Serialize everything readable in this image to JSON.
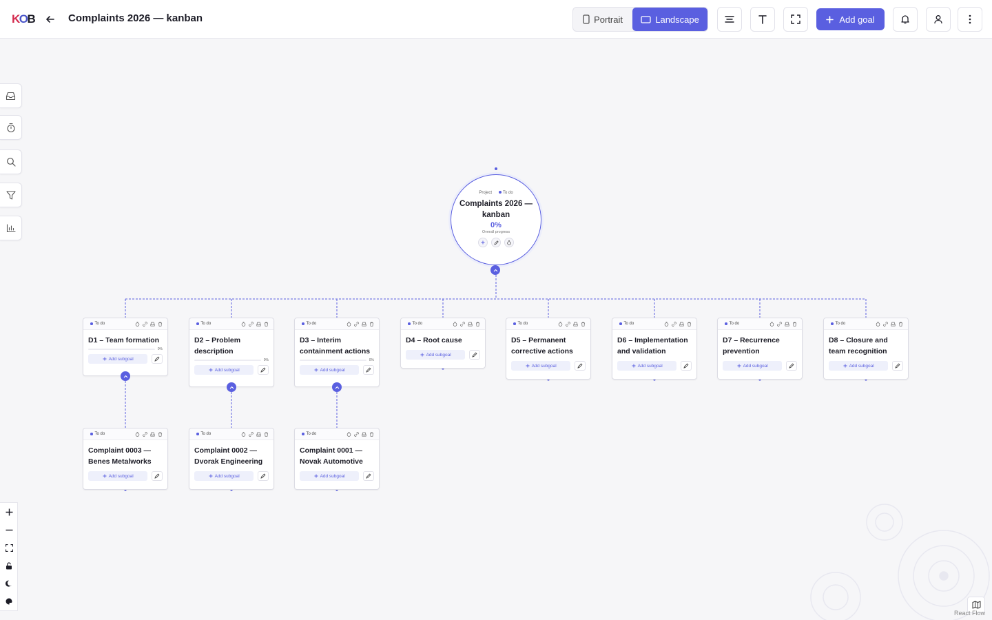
{
  "header": {
    "title": "Complaints 2026 — kanban",
    "orientation": {
      "portrait_label": "Portrait",
      "landscape_label": "Landscape",
      "selected": "landscape"
    },
    "add_goal_label": "Add goal",
    "icons": [
      "arrow-left-icon",
      "align-icon",
      "text-icon",
      "fullscreen-icon",
      "plus-icon",
      "bell-icon",
      "user-icon",
      "kebab-icon"
    ]
  },
  "sidebar": {
    "tools": [
      {
        "name": "inbox-icon"
      },
      {
        "name": "timer-icon"
      },
      {
        "name": "search-icon"
      },
      {
        "name": "filter-icon"
      },
      {
        "name": "chart-icon"
      }
    ]
  },
  "zoom_controls": [
    "zoom-in-icon",
    "zoom-out-icon",
    "fit-view-icon",
    "lock-icon",
    "moon-icon",
    "palette-icon"
  ],
  "root": {
    "type_label": "Project",
    "status": "To do",
    "title": "Complaints 2026 — kanban",
    "progress": "0%",
    "progress_label": "Overall progress"
  },
  "goals": [
    {
      "status": "To do",
      "title": "D1 – Team formation",
      "progress": "0%",
      "has_progress": true,
      "add_label": "Add subgoal",
      "expanded": true
    },
    {
      "status": "To do",
      "title": "D2 – Problem description",
      "progress": "0%",
      "has_progress": true,
      "add_label": "Add subgoal",
      "expanded": true
    },
    {
      "status": "To do",
      "title": "D3 – Interim containment actions",
      "progress": "0%",
      "has_progress": true,
      "add_label": "Add subgoal",
      "expanded": true
    },
    {
      "status": "To do",
      "title": "D4 – Root cause",
      "progress": "",
      "has_progress": false,
      "add_label": "Add subgoal",
      "expanded": false
    },
    {
      "status": "To do",
      "title": "D5 – Permanent corrective actions",
      "progress": "",
      "has_progress": false,
      "add_label": "Add subgoal",
      "expanded": false
    },
    {
      "status": "To do",
      "title": "D6 – Implementation and validation",
      "progress": "",
      "has_progress": false,
      "add_label": "Add subgoal",
      "expanded": false
    },
    {
      "status": "To do",
      "title": "D7 – Recurrence prevention",
      "progress": "",
      "has_progress": false,
      "add_label": "Add subgoal",
      "expanded": false
    },
    {
      "status": "To do",
      "title": "D8 – Closure and team recognition",
      "progress": "",
      "has_progress": false,
      "add_label": "Add subgoal",
      "expanded": false
    }
  ],
  "subgoals": [
    {
      "parent": 0,
      "status": "To do",
      "title": "Complaint 0003 — Benes Metalworks",
      "add_label": "Add subgoal"
    },
    {
      "parent": 1,
      "status": "To do",
      "title": "Complaint 0002 — Dvorak Engineering",
      "add_label": "Add subgoal"
    },
    {
      "parent": 2,
      "status": "To do",
      "title": "Complaint 0001 — Novak Automotive",
      "add_label": "Add subgoal"
    }
  ],
  "card_action_icons": [
    "timer-icon",
    "link-icon",
    "inbox-icon",
    "trash-icon"
  ],
  "attribution": "React Flow",
  "colors": {
    "accent": "#5a5fe0",
    "background": "#f6f6f8",
    "brand_red": "#d42b4e"
  }
}
